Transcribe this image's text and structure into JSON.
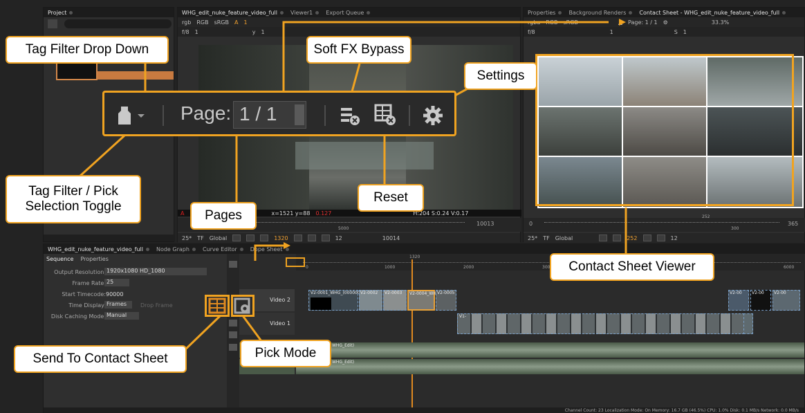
{
  "project_panel": {
    "tab": "Project"
  },
  "viewer_panel": {
    "tabs": [
      "WHG_edit_nuke_feature_video_full",
      "Viewer1",
      "Export Queue"
    ],
    "toolbar": {
      "channels": "rgb",
      "colorspace": "RGB",
      "lut": "sRGB",
      "a_label": "A",
      "a_num": "1",
      "fstop": "f/8",
      "one": "1",
      "y_label": "y",
      "y_val": "1"
    },
    "info_bar": "x=1521 y=88",
    "info_vals": "0.127",
    "hsv": "H:204 S:0.24 V:0.17",
    "timeline": {
      "fps": "25*",
      "tf": "TF",
      "global": "Global",
      "current_frame": "1320",
      "step": "12",
      "end_frame": "10013",
      "end_frame2": "10014",
      "tick_5000": "5000",
      "tick_10013": "10013"
    }
  },
  "contact_panel": {
    "tabs": [
      "Properties",
      "Background Renders",
      "Contact Sheet - WHG_edit_nuke_feature_video_full"
    ],
    "toolbar": {
      "channels": "rgba",
      "rgb": "RGB",
      "srgb": "sRGB",
      "page": "Page: 1 / 1",
      "zoom": "33.3%",
      "fstop": "f/8",
      "y_val": "1",
      "s_label": "S",
      "s_val": "1"
    },
    "timeline": {
      "fps": "25*",
      "tf": "TF",
      "global": "Global",
      "current_frame": "252",
      "step": "12",
      "start": "0",
      "end": "365",
      "tick_300": "300",
      "tick_365": "365",
      "marker": "252"
    }
  },
  "bottom": {
    "tabs": [
      "WHG_edit_nuke_feature_video_full",
      "Node Graph",
      "Curve Editor",
      "Dope Sheet"
    ],
    "sub_tabs": [
      "Sequence",
      "Properties"
    ],
    "properties": [
      {
        "label": "Output Resolution:",
        "value": "1920x1080 HD_1080"
      },
      {
        "label": "Frame Rate:",
        "value": "25"
      },
      {
        "label": "Start Timecode:",
        "value": "90000"
      },
      {
        "label": "Time Display:",
        "value": "Frames",
        "extra": "Drop Frame"
      },
      {
        "label": "Disk Caching Mode:",
        "value": "Manual"
      }
    ],
    "ruler": [
      "0",
      "1000",
      "2000",
      "3000",
      "6000"
    ],
    "playhead": "1320",
    "tracks": [
      {
        "name": "Video 2"
      },
      {
        "name": "Video 1"
      }
    ],
    "video2_clips": [
      "V2-0001_WHG_(000000",
      "V2-0002",
      "V2-0003",
      "V2-0004_WH",
      "V2-0005"
    ],
    "video2_right": [
      "V2-00",
      "V2-00",
      "V2-00"
    ],
    "video1_clip": "V1-",
    "audio_tracks": [
      "WHG_Edit)",
      "WHG_Edit)"
    ],
    "status": "Channel Count: 23  Localization Mode: On  Memory: 16.7 GB (46.5%)  CPU: 1.0%  Disk: 0.1 MB/s  Network: 0.0 MB/s"
  },
  "zoom_bar": {
    "page_label": "Page:",
    "page_value": "1 / 1"
  },
  "callouts": {
    "tag_filter_dropdown": "Tag Filter Drop Down",
    "soft_fx_bypass": "Soft FX Bypass",
    "settings": "Settings",
    "tag_filter_toggle": "Tag Filter / Pick Selection Toggle",
    "pages": "Pages",
    "reset": "Reset",
    "contact_sheet_viewer": "Contact Sheet Viewer",
    "send_to_contact_sheet": "Send To Contact Sheet",
    "pick_mode": "Pick Mode"
  },
  "colors": {
    "accent": "#f0a321",
    "panel": "#2e2e2e",
    "dark": "#1c1c1c",
    "clip_blue": "#7aa0c8",
    "audio_green": "#4d5a4d"
  }
}
